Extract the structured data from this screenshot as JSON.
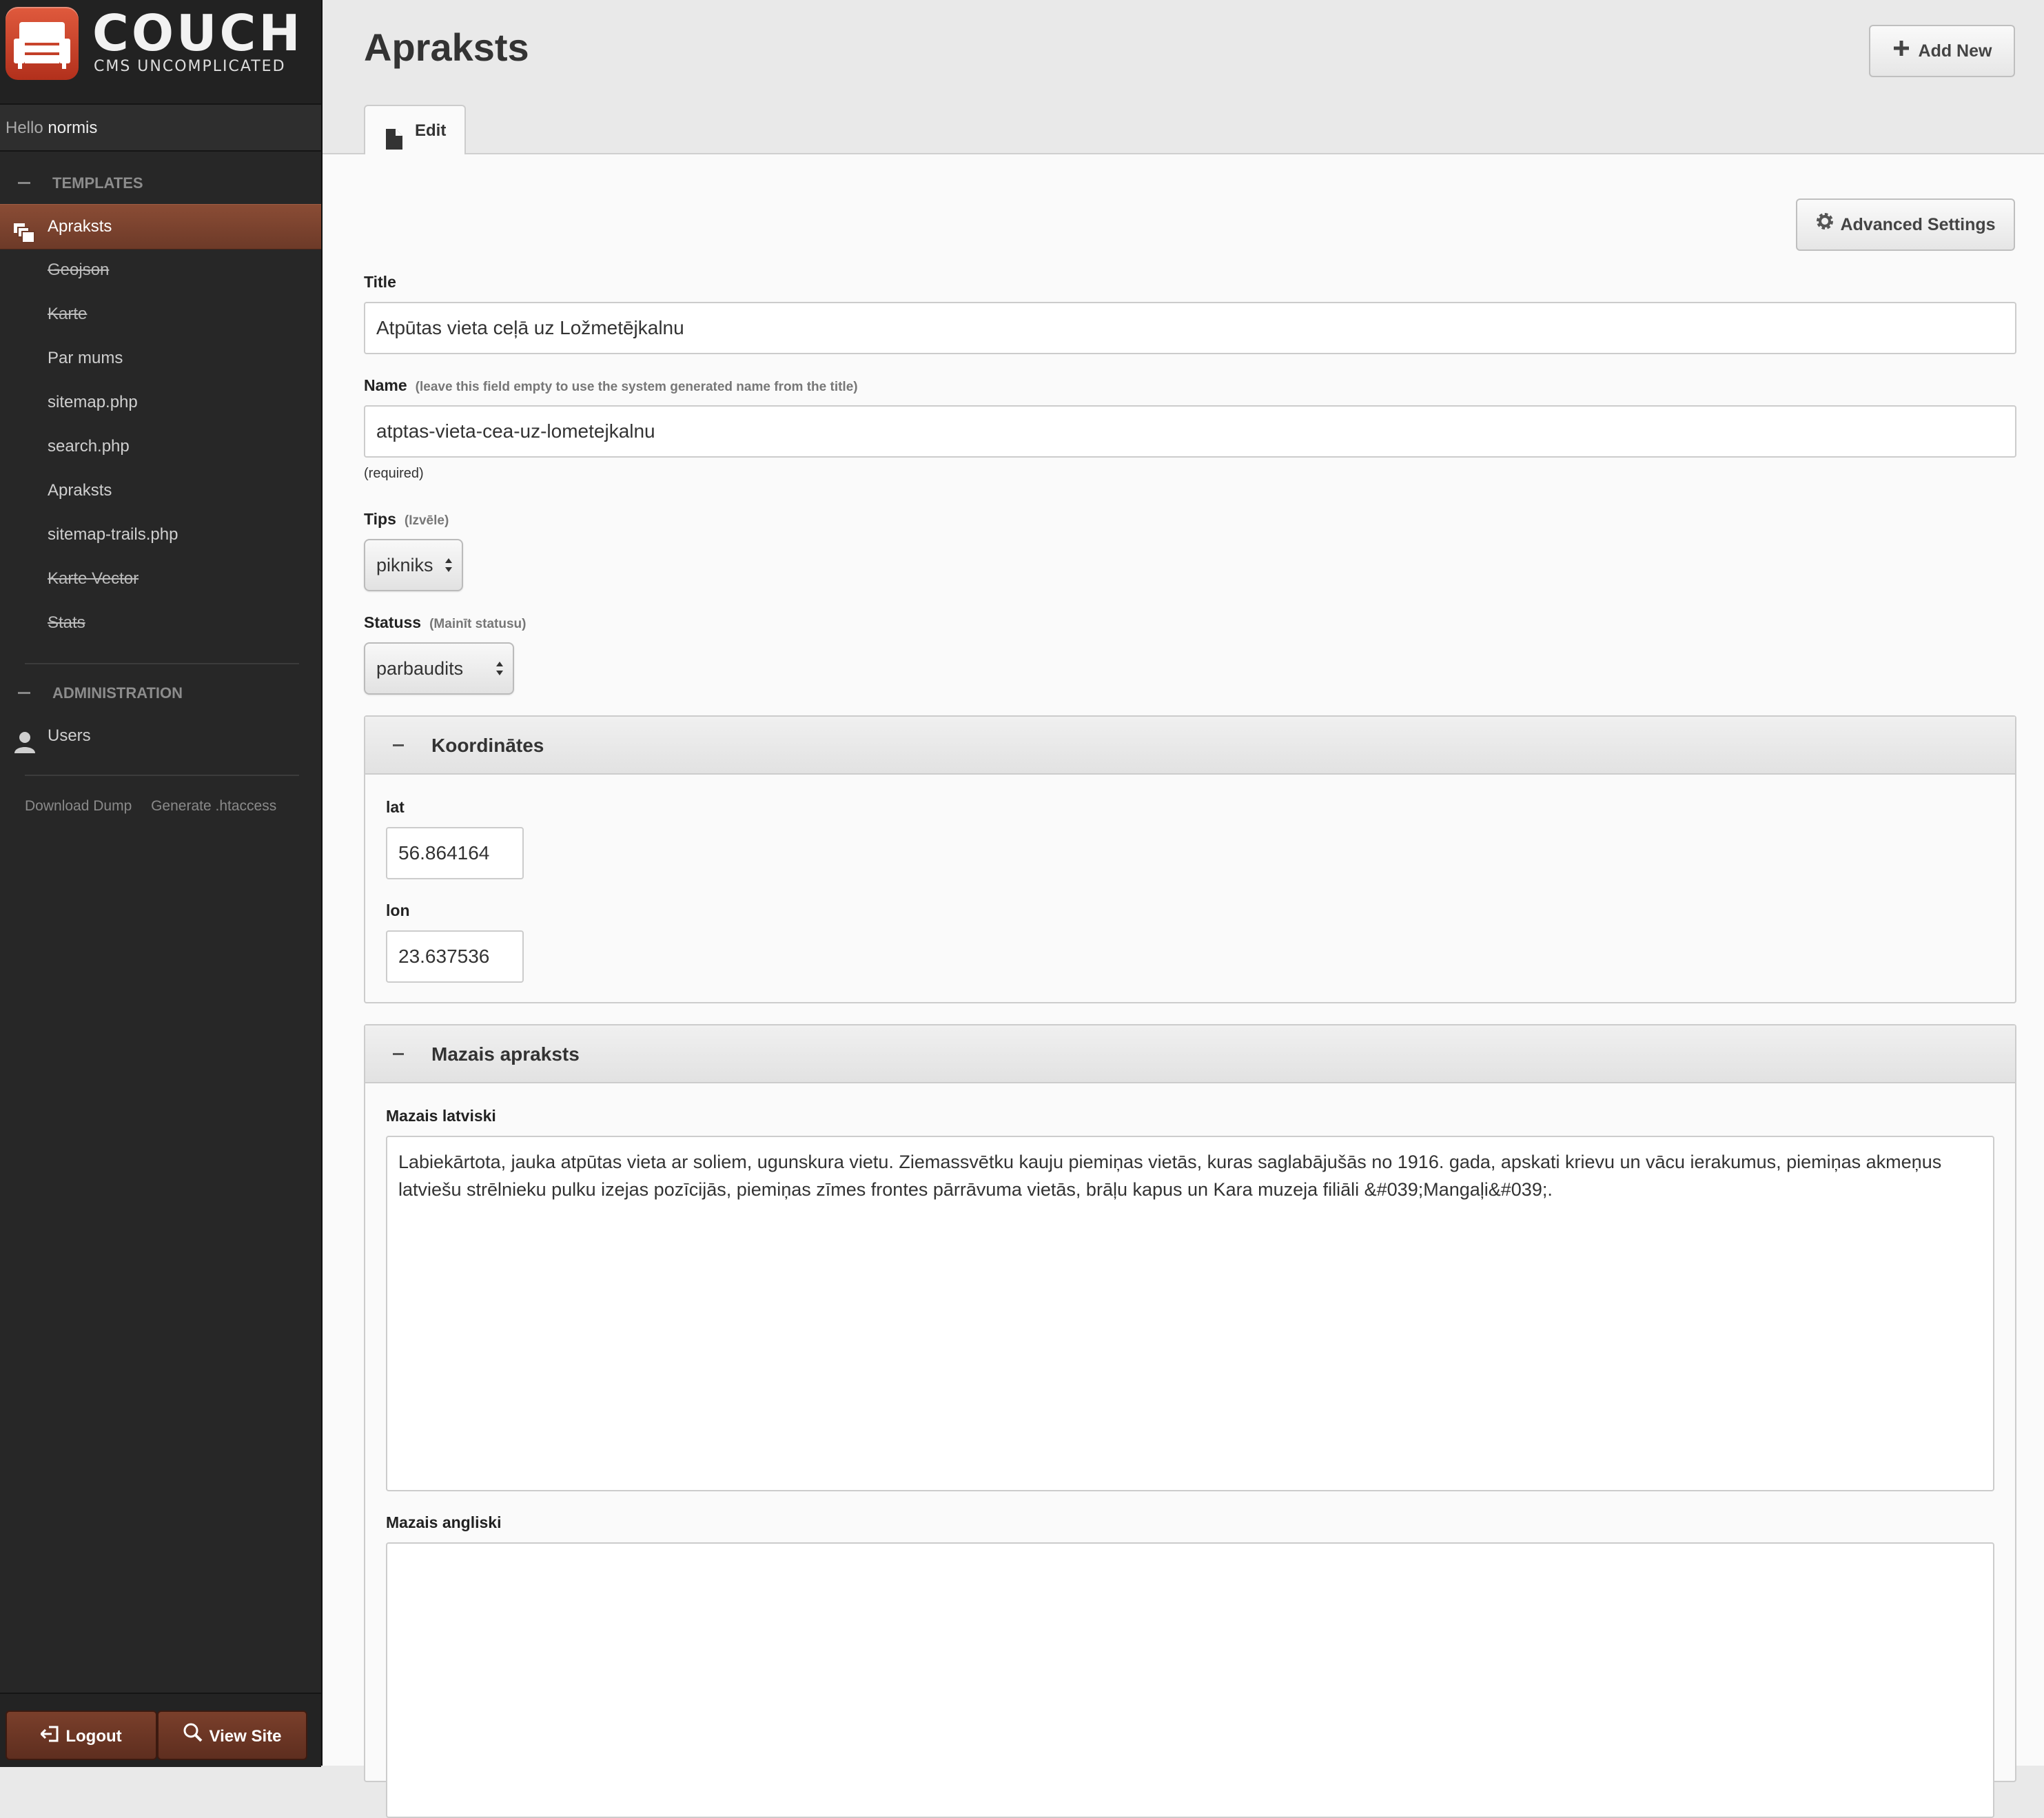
{
  "brand": {
    "name": "COUCH",
    "tagline": "CMS UNCOMPLICATED"
  },
  "user": {
    "greeting": "Hello",
    "name": "normis"
  },
  "sidebar": {
    "templates_heading": "TEMPLATES",
    "items": [
      {
        "label": "Apraksts",
        "active": true
      },
      {
        "label": "Geojson",
        "struck": true
      },
      {
        "label": "Karte",
        "struck": true
      },
      {
        "label": "Par mums"
      },
      {
        "label": "sitemap.php"
      },
      {
        "label": "search.php"
      },
      {
        "label": "Apraksts"
      },
      {
        "label": "sitemap-trails.php"
      },
      {
        "label": "Karte Vector",
        "struck": true
      },
      {
        "label": "Stats",
        "struck": true
      }
    ],
    "admin_heading": "ADMINISTRATION",
    "admin_items": [
      {
        "label": "Users"
      }
    ],
    "footer_links": [
      "Download Dump",
      "Generate .htaccess"
    ],
    "logout_label": "Logout",
    "view_site_label": "View Site"
  },
  "header": {
    "title": "Apraksts",
    "add_new_label": "Add New",
    "tabs": [
      {
        "label": "Edit"
      }
    ]
  },
  "form": {
    "advanced_settings_label": "Advanced Settings",
    "title_label": "Title",
    "title_value": "Atpūtas vieta ceļā uz Ložmetējkalnu",
    "name_label": "Name",
    "name_hint": "(leave this field empty to use the system generated name from the title)",
    "name_value": "atptas-vieta-cea-uz-lometejkalnu",
    "name_required": "(required)",
    "tips_label": "Tips",
    "tips_hint": "(Izvēle)",
    "tips_value": "pikniks",
    "status_label": "Statuss",
    "status_hint": "(Mainīt statusu)",
    "status_value": "parbaudits",
    "coords_group": {
      "title": "Koordinātes",
      "lat_label": "lat",
      "lat_value": "56.864164",
      "lon_label": "lon",
      "lon_value": "23.637536"
    },
    "desc_group": {
      "title": "Mazais apraksts",
      "lv_label": "Mazais latviski",
      "lv_value": "Labiekārtota, jauka atpūtas vieta ar soliem, ugunskura vietu. Ziemassvētku kauju piemiņas vietās, kuras saglabājušās no 1916. gada, apskati krievu un vācu ierakumus, piemiņas akmeņus latviešu strēlnieku pulku izejas pozīcijās, piemiņas zīmes frontes pārrāvuma vietās, brāļu kapus un Kara muzeja filiāli &#039;Mangaļi&#039;.",
      "en_label": "Mazais angliski",
      "en_value": ""
    }
  },
  "colors": {
    "sidebar_bg": "#272727",
    "accent": "#7a3f2b",
    "content_bg": "#fafafa",
    "header_bg": "#e9e9e9"
  }
}
